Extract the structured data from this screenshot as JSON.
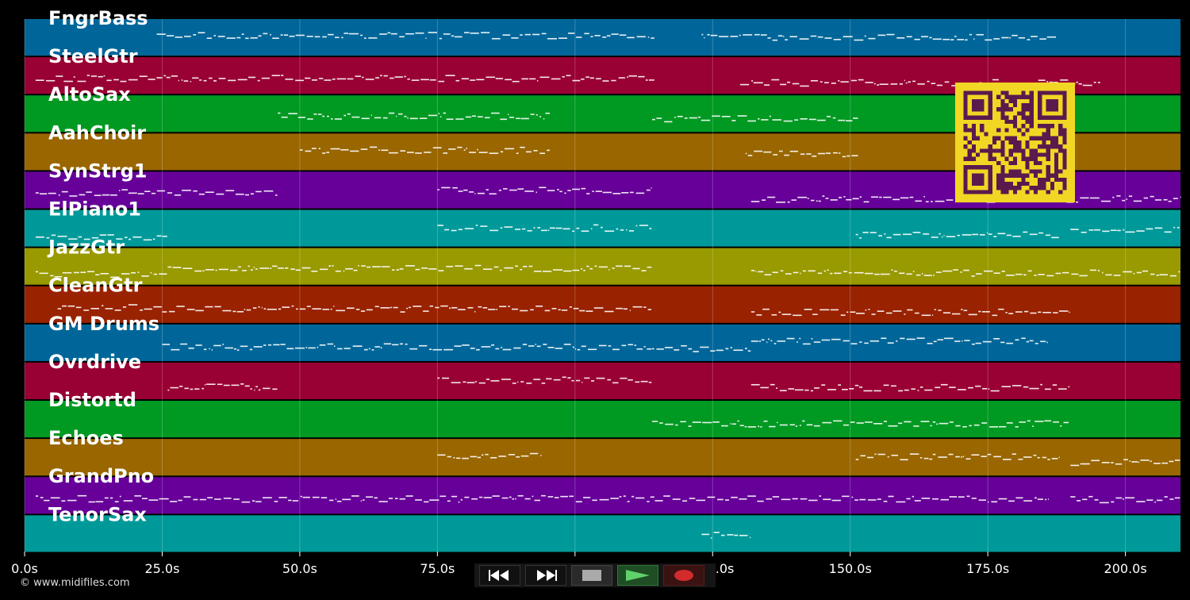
{
  "app": {
    "copyright": "© www.midifiles.com"
  },
  "tracks": [
    {
      "name": "FngrBass",
      "color": "#006699"
    },
    {
      "name": "SteelGtr",
      "color": "#990033"
    },
    {
      "name": "AltoSax",
      "color": "#009922"
    },
    {
      "name": "AahChoir",
      "color": "#996600"
    },
    {
      "name": "SynStrg1",
      "color": "#660099"
    },
    {
      "name": "ElPiano1",
      "color": "#009999"
    },
    {
      "name": "JazzGtr",
      "color": "#999900"
    },
    {
      "name": "CleanGtr",
      "color": "#992200"
    },
    {
      "name": "GM Drums",
      "color": "#006699"
    },
    {
      "name": "Ovrdrive",
      "color": "#990033"
    },
    {
      "name": "Distortd",
      "color": "#009922"
    },
    {
      "name": "Echoes",
      "color": "#996600"
    },
    {
      "name": "GrandPno",
      "color": "#660099"
    },
    {
      "name": "TenorSax",
      "color": "#009999"
    }
  ],
  "timeline": {
    "min_seconds": 0,
    "max_seconds": 210,
    "ticks": [
      "0.0s",
      "25.0s",
      "50.0s",
      "75.0s",
      "100.0s",
      "125.0s",
      "150.0s",
      "175.0s",
      "200.0s"
    ],
    "tick_values": [
      0,
      25,
      50,
      75,
      100,
      125,
      150,
      175,
      200
    ]
  },
  "activity": [
    [
      [
        24,
        114.5
      ],
      [
        123,
        187.5
      ]
    ],
    [
      [
        2,
        114.5
      ],
      [
        130,
        195.5
      ]
    ],
    [
      [
        46,
        95.5
      ],
      [
        114,
        151.5
      ]
    ],
    [
      [
        50,
        95.5
      ],
      [
        131,
        151.5
      ]
    ],
    [
      [
        2,
        46
      ],
      [
        75,
        114
      ],
      [
        132,
        210
      ]
    ],
    [
      [
        2,
        26
      ],
      [
        75,
        114
      ],
      [
        151,
        188
      ],
      [
        190,
        210
      ]
    ],
    [
      [
        2,
        26
      ],
      [
        26,
        114
      ],
      [
        132,
        210
      ]
    ],
    [
      [
        6,
        25
      ],
      [
        25,
        114
      ],
      [
        132,
        190
      ]
    ],
    [
      [
        25,
        114
      ],
      [
        114,
        132
      ],
      [
        132,
        186
      ]
    ],
    [
      [
        26,
        46
      ],
      [
        75,
        114
      ],
      [
        132,
        190
      ]
    ],
    [
      [
        114,
        190
      ]
    ],
    [
      [
        75,
        94
      ],
      [
        151,
        188
      ],
      [
        190,
        210
      ]
    ],
    [
      [
        2,
        186
      ],
      [
        190,
        210
      ]
    ],
    [
      [
        123,
        132
      ]
    ]
  ],
  "transport": {
    "buttons": [
      {
        "name": "rewind",
        "icon": "rewind-icon"
      },
      {
        "name": "fast-forward",
        "icon": "fast-forward-icon"
      },
      {
        "name": "stop",
        "icon": "stop-icon"
      },
      {
        "name": "play",
        "icon": "play-icon"
      },
      {
        "name": "record",
        "icon": "record-icon"
      }
    ]
  },
  "colors": {
    "background": "#000000",
    "grid": "#ffffff",
    "note": "#ffffff",
    "qr_fg": "#5a1a4e",
    "qr_bg": "#f2d624"
  }
}
